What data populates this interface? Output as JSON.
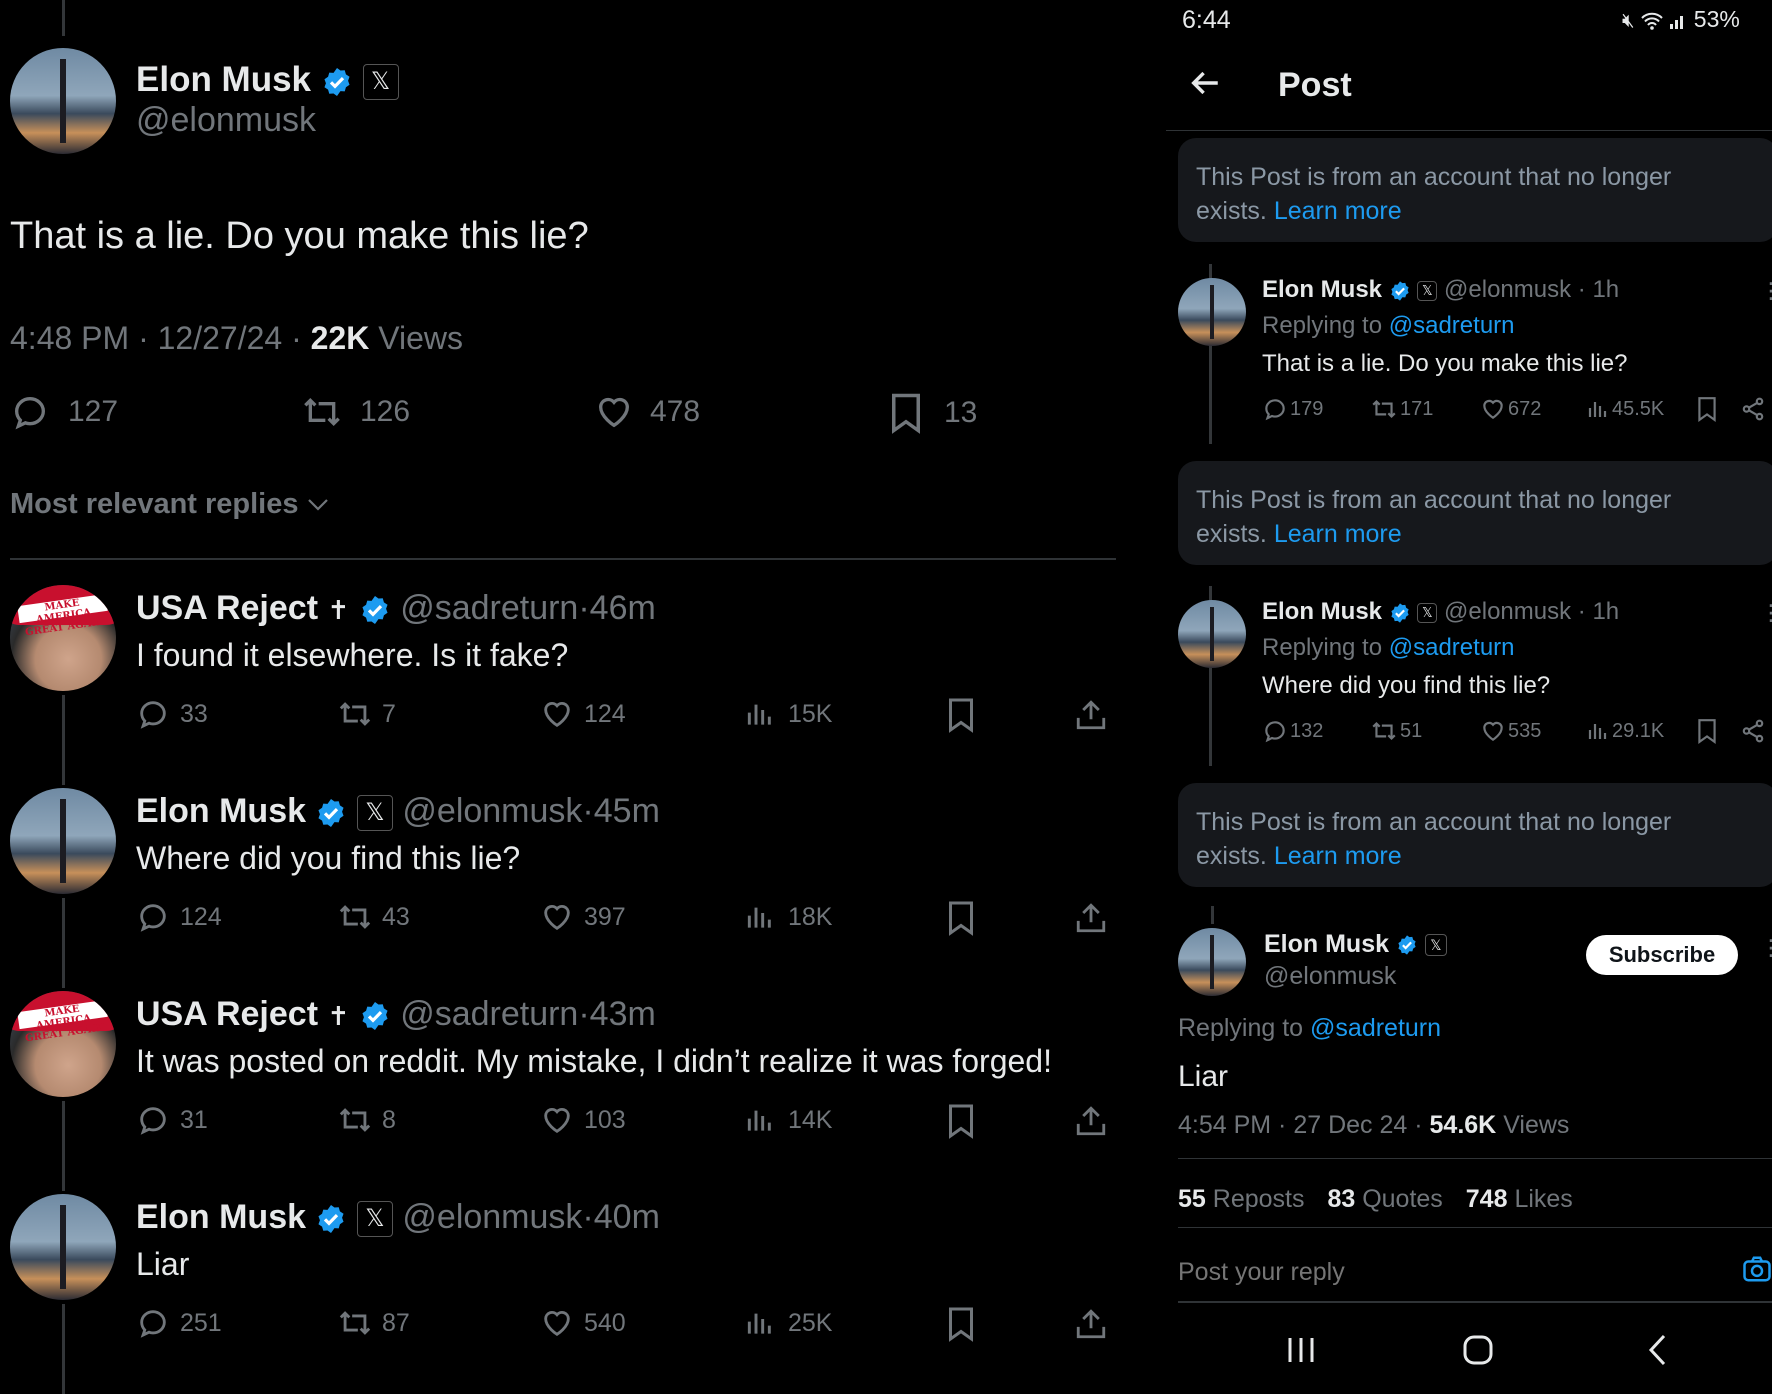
{
  "left": {
    "main_post": {
      "name": "Elon Musk",
      "handle": "@elonmusk",
      "text": "That is a lie. Do you make this lie?",
      "time": "4:48 PM",
      "date": "12/27/24",
      "views_count": "22K",
      "views_label": "Views",
      "replies": "127",
      "reposts": "126",
      "likes": "478",
      "bookmarks": "13"
    },
    "sort_label": "Most relevant replies",
    "replies": [
      {
        "name": "USA Reject",
        "handle": "@sadreturn",
        "sep": "·",
        "age": "46m",
        "text": "I found it elsewhere. Is it fake?",
        "replies": "33",
        "reposts": "7",
        "likes": "124",
        "views": "15K",
        "avatar": "usa",
        "hat_text": "MAKE AMERICA GREAT AGAIN"
      },
      {
        "name": "Elon Musk",
        "handle": "@elonmusk",
        "sep": "·",
        "age": "45m",
        "text": "Where did you find this lie?",
        "replies": "124",
        "reposts": "43",
        "likes": "397",
        "views": "18K",
        "avatar": "elon"
      },
      {
        "name": "USA Reject",
        "handle": "@sadreturn",
        "sep": "·",
        "age": "43m",
        "text": "It was posted on reddit. My mistake, I didn’t realize it was forged!",
        "replies": "31",
        "reposts": "8",
        "likes": "103",
        "views": "14K",
        "avatar": "usa",
        "hat_text": "MAKE AMERICA GREAT AGAIN"
      },
      {
        "name": "Elon Musk",
        "handle": "@elonmusk",
        "sep": "·",
        "age": "40m",
        "text": "Liar",
        "replies": "251",
        "reposts": "87",
        "likes": "540",
        "views": "25K",
        "avatar": "elon"
      }
    ],
    "cross_glyph": "✝",
    "x_glyph": "𝕏"
  },
  "right": {
    "status": {
      "time": "6:44",
      "battery": "53%"
    },
    "header_title": "Post",
    "notice_text": "This Post is from an account that no longer exists.",
    "notice_link": "Learn more",
    "thread": [
      {
        "name": "Elon Musk",
        "handle": "@elonmusk",
        "age": "· 1h",
        "replying_label": "Replying to",
        "replying_to": "@sadreturn",
        "text": "That is a lie. Do you make this lie?",
        "replies": "179",
        "reposts": "171",
        "likes": "672",
        "views": "45.5K"
      },
      {
        "name": "Elon Musk",
        "handle": "@elonmusk",
        "age": "· 1h",
        "replying_label": "Replying to",
        "replying_to": "@sadreturn",
        "text": "Where did you find this lie?",
        "replies": "132",
        "reposts": "51",
        "likes": "535",
        "views": "29.1K"
      }
    ],
    "focus": {
      "name": "Elon Musk",
      "handle": "@elonmusk",
      "subscribe_label": "Subscribe",
      "replying_label": "Replying to",
      "replying_to": "@sadreturn",
      "text": "Liar",
      "time": "4:54 PM",
      "date": "27 Dec 24",
      "views_count": "54.6K",
      "views_label": "Views",
      "reposts_count": "55",
      "reposts_label": "Reposts",
      "quotes_count": "83",
      "quotes_label": "Quotes",
      "likes_count": "748",
      "likes_label": "Likes"
    },
    "reply_placeholder": "Post your reply"
  },
  "colors": {
    "accent": "#1d9bf0",
    "muted": "#71767b",
    "text": "#e7e9ea",
    "notice_bg": "#16181c"
  }
}
